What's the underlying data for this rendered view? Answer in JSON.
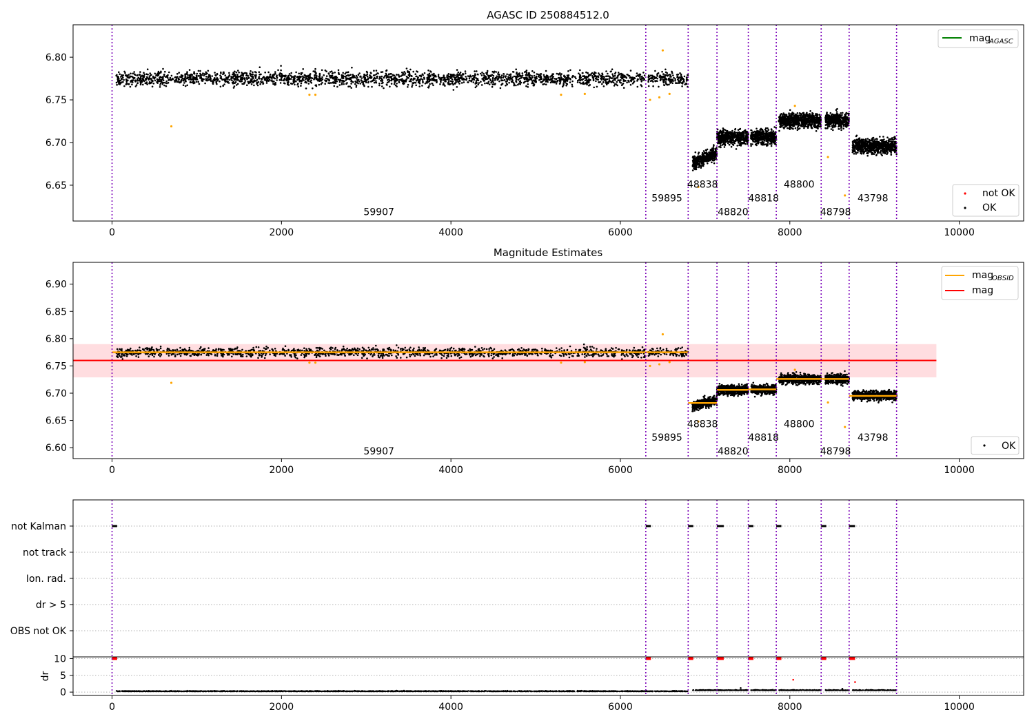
{
  "chart_data": [
    {
      "type": "scatter",
      "title": "AGASC ID 250884512.0",
      "xlim": [
        -460,
        10760
      ],
      "ylim": [
        6.608,
        6.838
      ],
      "xticks": [
        0,
        2000,
        4000,
        6000,
        8000,
        10000
      ],
      "xtick_labels": [
        "0",
        "2000",
        "4000",
        "6000",
        "8000",
        "10000"
      ],
      "yticks": [
        6.65,
        6.7,
        6.75,
        6.8
      ],
      "ytick_labels": [
        "6.65",
        "6.70",
        "6.75",
        "6.80"
      ],
      "obs_boundaries": [
        0,
        6300,
        6800,
        7140,
        7510,
        7840,
        8370,
        8700,
        9260
      ],
      "segments": [
        {
          "x0": 50,
          "x1": 6800,
          "level": 6.775,
          "noise": 0.006,
          "gap": [
            6290,
            6330
          ]
        },
        {
          "x0": 6850,
          "x1": 7140,
          "level": 6.682,
          "noise": 0.006,
          "trend": 0.012
        },
        {
          "x0": 7140,
          "x1": 7510,
          "level": 6.706,
          "noise": 0.006
        },
        {
          "x0": 7540,
          "x1": 7840,
          "level": 6.707,
          "noise": 0.006
        },
        {
          "x0": 7870,
          "x1": 8370,
          "level": 6.726,
          "noise": 0.006
        },
        {
          "x0": 8420,
          "x1": 8700,
          "level": 6.726,
          "noise": 0.006
        },
        {
          "x0": 8740,
          "x1": 9260,
          "level": 6.696,
          "noise": 0.006
        }
      ],
      "outliers": [
        [
          700,
          6.719
        ],
        [
          2330,
          6.756
        ],
        [
          2400,
          6.756
        ],
        [
          5300,
          6.756
        ],
        [
          5580,
          6.757
        ],
        [
          6350,
          6.75
        ],
        [
          6460,
          6.753
        ],
        [
          6500,
          6.808
        ],
        [
          6580,
          6.757
        ],
        [
          8060,
          6.743
        ],
        [
          8450,
          6.683
        ],
        [
          8650,
          6.638
        ],
        [
          6920,
          6.648
        ]
      ],
      "obs_labels": [
        {
          "text": "59907",
          "x": 3150,
          "y": 6.619
        },
        {
          "text": "59895",
          "x": 6550,
          "y": 6.635
        },
        {
          "text": "48838",
          "x": 6970,
          "y": 6.651
        },
        {
          "text": "48820",
          "x": 7330,
          "y": 6.619
        },
        {
          "text": "48818",
          "x": 7690,
          "y": 6.635
        },
        {
          "text": "48800",
          "x": 8110,
          "y": 6.651
        },
        {
          "text": "48798",
          "x": 8540,
          "y": 6.619
        },
        {
          "text": "43798",
          "x": 8980,
          "y": 6.635
        }
      ],
      "legend_top": {
        "placement": "upper right",
        "label": "mag",
        "subscript": "AGASC",
        "color": "#008000"
      },
      "legend_bottom": {
        "placement": "lower right",
        "entries": [
          {
            "label": "not OK",
            "color": "#ff0000"
          },
          {
            "label": "OK",
            "color": "#000000"
          }
        ]
      }
    },
    {
      "type": "scatter",
      "title": "Magnitude Estimates",
      "xlim": [
        -460,
        10760
      ],
      "ylim": [
        6.58,
        6.94
      ],
      "xticks": [
        0,
        2000,
        4000,
        6000,
        8000,
        10000
      ],
      "xtick_labels": [
        "0",
        "2000",
        "4000",
        "6000",
        "8000",
        "10000"
      ],
      "yticks": [
        6.6,
        6.65,
        6.7,
        6.75,
        6.8,
        6.85,
        6.9
      ],
      "ytick_labels": [
        "6.60",
        "6.65",
        "6.70",
        "6.75",
        "6.80",
        "6.85",
        "6.90"
      ],
      "mag_line": {
        "value": 6.76,
        "x0": -460,
        "x1": 9730,
        "band": [
          6.729,
          6.79
        ],
        "color": "#ff0000"
      },
      "obsid_levels": [
        {
          "x0": 0,
          "x1": 6800,
          "value": 6.775
        },
        {
          "x0": 6800,
          "x1": 7140,
          "value": 6.682
        },
        {
          "x0": 7140,
          "x1": 7510,
          "value": 6.706
        },
        {
          "x0": 7510,
          "x1": 7840,
          "value": 6.707
        },
        {
          "x0": 7840,
          "x1": 8370,
          "value": 6.726
        },
        {
          "x0": 8370,
          "x1": 8700,
          "value": 6.726
        },
        {
          "x0": 8700,
          "x1": 9260,
          "value": 6.695
        }
      ],
      "obs_labels": [
        {
          "text": "59907",
          "x": 3150,
          "y": 6.594
        },
        {
          "text": "59895",
          "x": 6550,
          "y": 6.619
        },
        {
          "text": "48838",
          "x": 6970,
          "y": 6.644
        },
        {
          "text": "48820",
          "x": 7330,
          "y": 6.594
        },
        {
          "text": "48818",
          "x": 7690,
          "y": 6.619
        },
        {
          "text": "48800",
          "x": 8110,
          "y": 6.644
        },
        {
          "text": "48798",
          "x": 8540,
          "y": 6.594
        },
        {
          "text": "43798",
          "x": 8980,
          "y": 6.619
        }
      ],
      "legend_top": {
        "placement": "upper right",
        "entries": [
          {
            "label": "mag",
            "subscript": "OBSID",
            "color": "#ffa500"
          },
          {
            "label": "mag",
            "color": "#ff0000"
          }
        ]
      },
      "legend_bottom": {
        "placement": "lower right",
        "entries": [
          {
            "label": "OK",
            "color": "#000000"
          }
        ]
      }
    },
    {
      "type": "scatter",
      "title": "",
      "xlim": [
        -460,
        10760
      ],
      "flag_labels": [
        "not Kalman",
        "not track",
        "Ion. rad.",
        "dr > 5",
        "OBS not OK"
      ],
      "flag_spans": [
        [
          0,
          60
        ],
        [
          6300,
          6360
        ],
        [
          6800,
          6860
        ],
        [
          7140,
          7220
        ],
        [
          7510,
          7570
        ],
        [
          7840,
          7900
        ],
        [
          8370,
          8430
        ],
        [
          8700,
          8770
        ]
      ],
      "dr_ylabel": "dr",
      "dr_yticks": [
        0,
        5,
        10
      ],
      "dr_ytick_labels": [
        "0",
        "5",
        "10"
      ],
      "dr_ylim": [
        -1,
        10.5
      ],
      "dr_extra": [
        [
          8040,
          3.7
        ],
        [
          8770,
          3.0
        ],
        [
          7420,
          1.2
        ],
        [
          8620,
          1.0
        ]
      ],
      "xticks": [
        0,
        2000,
        4000,
        6000,
        8000,
        10000
      ],
      "xtick_labels": [
        "0",
        "2000",
        "4000",
        "6000",
        "8000",
        "10000"
      ]
    }
  ]
}
